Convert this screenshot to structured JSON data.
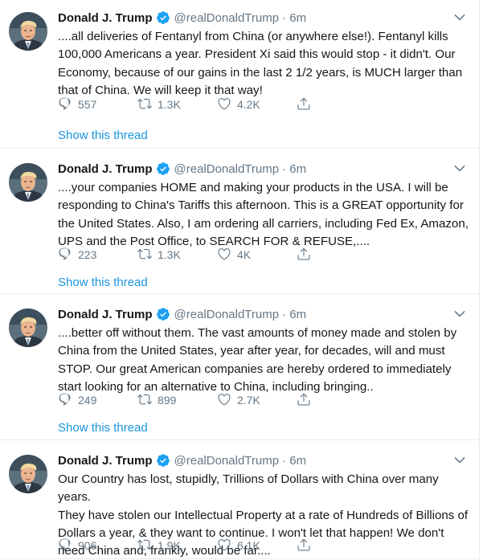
{
  "colors": {
    "link": "#1b95e0",
    "muted": "#657786",
    "text": "#14171a",
    "verified": "#1da1f2"
  },
  "tweets": [
    {
      "name": "Donald J. Trump",
      "handle": "@realDonaldTrump",
      "time": "· 6m",
      "text": "....all deliveries of Fentanyl from China (or anywhere else!). Fentanyl kills\n100,000 Americans a year. President Xi said this would stop - it didn't. Our\nEconomy, because of our gains in the last 2 1/2 years, is MUCH larger than\nthat of China. We will keep it that way!",
      "replies": "557",
      "retweets": "1.3K",
      "likes": "4.2K",
      "thread_label": "Show this thread"
    },
    {
      "name": "Donald J. Trump",
      "handle": "@realDonaldTrump",
      "time": "· 6m",
      "text": "....your companies HOME and making your products in the USA. I will be\nresponding to China's Tariffs this afternoon. This is a GREAT opportunity for\nthe United States. Also, I am ordering all carriers, including Fed Ex, Amazon,\nUPS and the Post Office, to SEARCH FOR & REFUSE,....",
      "replies": "223",
      "retweets": "1.3K",
      "likes": "4K",
      "thread_label": "Show this thread"
    },
    {
      "name": "Donald J. Trump",
      "handle": "@realDonaldTrump",
      "time": "· 6m",
      "text": "....better off without them. The vast amounts of money made and stolen by\nChina from the United States, year after year, for decades, will and must\nSTOP. Our great American companies are hereby ordered to immediately\nstart looking for an alternative to China, including bringing..",
      "replies": "249",
      "retweets": "899",
      "likes": "2.7K",
      "thread_label": "Show this thread"
    },
    {
      "name": "Donald J. Trump",
      "handle": "@realDonaldTrump",
      "time": "· 6m",
      "text": "Our Country has lost, stupidly, Trillions of Dollars with China over many years.\nThey have stolen our Intellectual Property at a rate of Hundreds of Billions of\nDollars a year, & they want to continue. I won't let that happen! We don't\nneed China and, frankly, would be far....",
      "replies": "906",
      "retweets": "1.9K",
      "likes": "6.1K"
    }
  ]
}
